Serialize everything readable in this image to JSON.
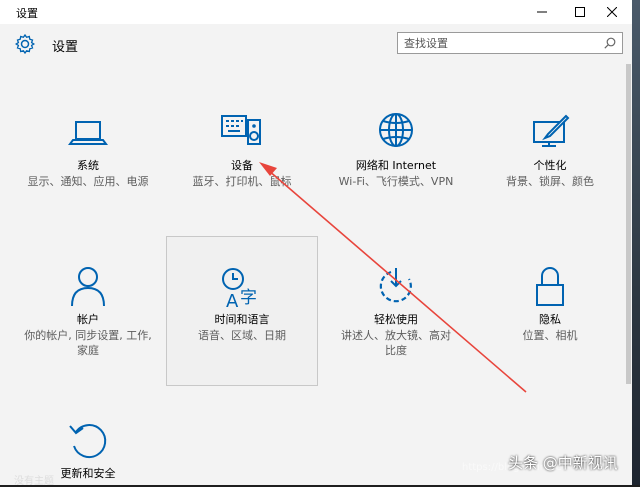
{
  "window": {
    "title": "设置",
    "controls": [
      "minimize-icon",
      "maximize-icon",
      "close-icon"
    ]
  },
  "header": {
    "app_title": "设置",
    "search_placeholder": "查找设置"
  },
  "tiles": [
    {
      "label": "系统",
      "desc": "显示、通知、应用、电源",
      "icon": "laptop-icon"
    },
    {
      "label": "设备",
      "desc": "蓝牙、打印机、鼠标",
      "icon": "keyboard-speaker-icon"
    },
    {
      "label": "网络和 Internet",
      "desc": "Wi-Fi、飞行模式、VPN",
      "icon": "globe-icon"
    },
    {
      "label": "个性化",
      "desc": "背景、锁屏、颜色",
      "icon": "paint-monitor-icon"
    },
    {
      "label": "帐户",
      "desc": "你的帐户, 同步设置, 工作, 家庭",
      "icon": "person-icon"
    },
    {
      "label": "时间和语言",
      "desc": "语音、区域、日期",
      "icon": "clock-language-icon"
    },
    {
      "label": "轻松使用",
      "desc": "讲述人、放大镜、高对比度",
      "icon": "ease-of-access-icon"
    },
    {
      "label": "隐私",
      "desc": "位置、相机",
      "icon": "lock-icon"
    },
    {
      "label": "更新和安全",
      "desc": "",
      "icon": "update-icon"
    }
  ],
  "overlay": {
    "watermark": "https://blog.csdn.net",
    "brand": "头条 @中新视讯",
    "cutoff_text": "没有主题",
    "arrow_color": "#e8453c"
  },
  "colors": {
    "accent": "#0063b1",
    "background": "#f3f3f3"
  }
}
